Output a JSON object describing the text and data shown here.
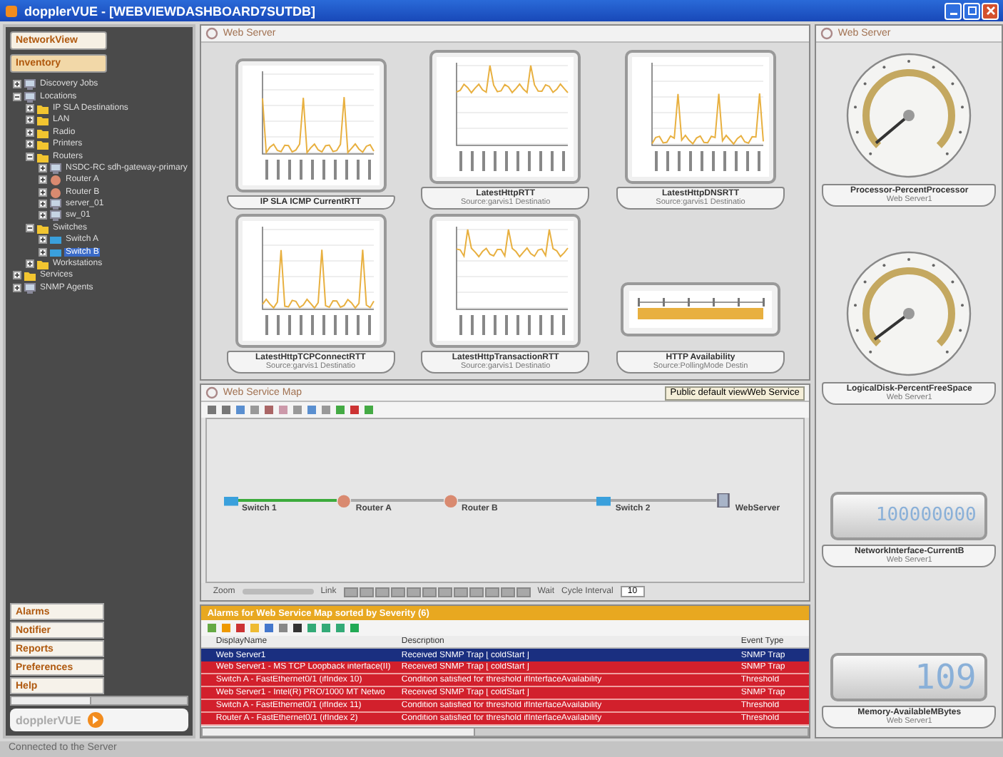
{
  "window": {
    "title": "dopplerVUE - [WEBVIEWDASHBOARD7SUTDB]"
  },
  "sidebar": {
    "top_buttons": [
      {
        "label": "NetworkView",
        "selected": false
      },
      {
        "label": "Inventory",
        "selected": true
      }
    ],
    "tree": [
      {
        "label": "Discovery Jobs",
        "kind": "device",
        "expanded": false,
        "selected": false
      },
      {
        "label": "Locations",
        "kind": "device",
        "expanded": true,
        "selected": false,
        "children": [
          {
            "label": "IP SLA Destinations",
            "kind": "folder",
            "expanded": false,
            "selected": false
          },
          {
            "label": "LAN",
            "kind": "folder",
            "expanded": false,
            "selected": false
          },
          {
            "label": "Radio",
            "kind": "folder",
            "expanded": false,
            "selected": false
          },
          {
            "label": "Printers",
            "kind": "folder",
            "expanded": false,
            "selected": false
          },
          {
            "label": "Routers",
            "kind": "folder",
            "expanded": true,
            "selected": false,
            "children": [
              {
                "label": "NSDC-RC sdh-gateway-primary",
                "kind": "device",
                "expanded": false,
                "selected": false
              },
              {
                "label": "Router A",
                "kind": "router",
                "expanded": false,
                "selected": false
              },
              {
                "label": "Router B",
                "kind": "router",
                "expanded": false,
                "selected": false
              },
              {
                "label": "server_01",
                "kind": "device",
                "expanded": false,
                "selected": false
              },
              {
                "label": "sw_01",
                "kind": "device",
                "expanded": false,
                "selected": false
              }
            ]
          },
          {
            "label": "Switches",
            "kind": "folder",
            "expanded": true,
            "selected": false,
            "children": [
              {
                "label": "Switch A",
                "kind": "switch",
                "expanded": false,
                "selected": false
              },
              {
                "label": "Switch B",
                "kind": "switch",
                "expanded": false,
                "selected": true
              }
            ]
          },
          {
            "label": "Workstations",
            "kind": "folder",
            "expanded": false,
            "selected": false
          }
        ]
      },
      {
        "label": "Services",
        "kind": "folder",
        "expanded": false,
        "selected": false
      },
      {
        "label": "SNMP Agents",
        "kind": "device",
        "expanded": false,
        "selected": false
      }
    ],
    "bottom_buttons": [
      {
        "label": "Alarms"
      },
      {
        "label": "Notifier"
      },
      {
        "label": "Reports"
      },
      {
        "label": "Preferences"
      },
      {
        "label": "Help"
      }
    ],
    "logo": "dopplerVUE"
  },
  "dashboard": {
    "title": "Web Server",
    "widgets": [
      {
        "kind": "chart",
        "title": "IP SLA ICMP CurrentRTT"
      },
      {
        "kind": "chart",
        "title": "LatestHttpRTT",
        "subtitle": "Source:garvis1 Destinatio"
      },
      {
        "kind": "chart",
        "title": "LatestHttpDNSRTT",
        "subtitle": "Source:garvis1 Destinatio"
      },
      {
        "kind": "chart",
        "title": "LatestHttpTCPConnectRTT",
        "subtitle": "Source:garvis1 Destinatio"
      },
      {
        "kind": "chart",
        "title": "LatestHttpTransactionRTT",
        "subtitle": "Source:garvis1 Destinatio"
      },
      {
        "kind": "bar",
        "title": "HTTP Availability",
        "subtitle": "Source:PollingMode Destin"
      }
    ]
  },
  "service_map": {
    "title": "Web Service Map",
    "view_button": "Public default viewWeb Service",
    "nodes": [
      {
        "label": "Switch 1",
        "kind": "switch"
      },
      {
        "label": "Router A",
        "kind": "router"
      },
      {
        "label": "Router B",
        "kind": "router"
      },
      {
        "label": "Switch 2",
        "kind": "switch"
      },
      {
        "label": "WebServer",
        "kind": "server"
      }
    ],
    "links": [
      {
        "up": true
      },
      {
        "up": false
      },
      {
        "up": false
      },
      {
        "up": false
      }
    ],
    "zoom_label": "Zoom",
    "link_label": "Link",
    "wait_label": "Wait",
    "cycle_label": "Cycle Interval",
    "cycle_value": "10"
  },
  "events": {
    "title": "Alarms for Web Service Map sorted by Severity (6)",
    "columns": [
      "DisplayName",
      "Description",
      "Event Type"
    ],
    "rows": [
      {
        "selected": true,
        "cells": [
          "Web Server1",
          "Received SNMP Trap [ coldStart ]",
          "SNMP Trap"
        ]
      },
      {
        "selected": false,
        "cells": [
          "Web Server1 - MS TCP Loopback interface(II)",
          "Received SNMP Trap [ coldStart ]",
          "SNMP Trap"
        ]
      },
      {
        "selected": false,
        "cells": [
          "Switch A - FastEthernet0/1 (ifIndex 10)",
          "Condition satisfied for threshold ifInterfaceAvailability",
          "Threshold"
        ]
      },
      {
        "selected": false,
        "cells": [
          "Web Server1 - Intel(R) PRO/1000 MT Netwo",
          "Received SNMP Trap [ coldStart ]",
          "SNMP Trap"
        ]
      },
      {
        "selected": false,
        "cells": [
          "Switch A - FastEthernet0/1 (ifIndex 11)",
          "Condition satisfied for threshold ifInterfaceAvailability",
          "Threshold"
        ]
      },
      {
        "selected": false,
        "cells": [
          "Router A - FastEthernet0/1 (ifIndex 2)",
          "Condition satisfied for threshold ifInterfaceAvailability",
          "Threshold"
        ]
      }
    ]
  },
  "side_dashboard": {
    "title": "Web Server",
    "widgets": [
      {
        "kind": "gauge",
        "title": "Processor-PercentProcessor",
        "subtitle": "Web Server1"
      },
      {
        "kind": "gauge",
        "title": "LogicalDisk-PercentFreeSpace",
        "subtitle": "Web Server1"
      },
      {
        "kind": "digital",
        "title": "NetworkInterface-CurrentB",
        "subtitle": "Web Server1",
        "value": "100000000"
      },
      {
        "kind": "digital",
        "title": "Memory-AvailableMBytes",
        "subtitle": "Web Server1",
        "value": "109"
      }
    ]
  },
  "status_bar": "Connected to the Server"
}
